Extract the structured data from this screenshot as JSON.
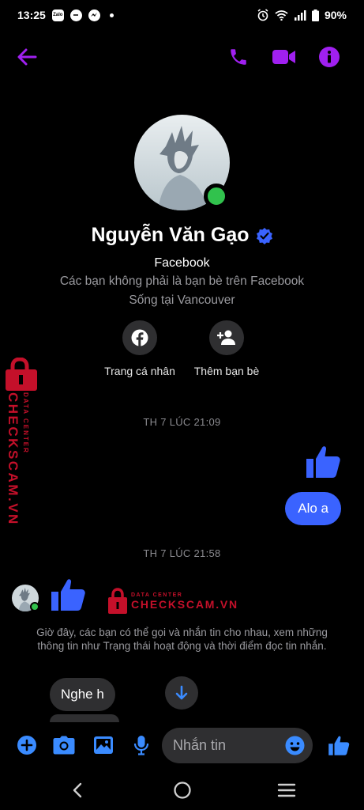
{
  "status_bar": {
    "time": "13:25",
    "notifications": [
      {
        "icon": "zalo-icon",
        "text": "Zalo"
      },
      {
        "icon": "chat-bubble-icon",
        "text": ""
      },
      {
        "icon": "messenger-icon",
        "text": ""
      }
    ],
    "battery": "90%"
  },
  "header": {
    "back": "back-arrow-icon",
    "call": "phone-icon",
    "video": "video-camera-icon",
    "info": "info-icon"
  },
  "profile": {
    "name": "Nguyễn Văn Gạo",
    "verified": true,
    "platform": "Facebook",
    "friend_status": "Các bạn không phải là bạn bè trên Facebook",
    "lives_in": "Sống tại Vancouver",
    "actions": [
      {
        "icon": "facebook-icon",
        "label": "Trang cá nhân"
      },
      {
        "icon": "add-friend-icon",
        "label": "Thêm bạn bè"
      }
    ]
  },
  "watermark": {
    "small": "DATA CENTER",
    "big": "CHECKSCAM.VN"
  },
  "messages": {
    "timestamp_1": "TH 7 LÚC 21:09",
    "outgoing_text": "Alo a",
    "timestamp_2": "TH 7 LÚC 21:58",
    "system_notice": "Giờ đây, các bạn có thể gọi và nhắn tin cho nhau, xem những thông tin như Trạng thái hoạt động và thời điểm đọc tin nhắn.",
    "incoming_text": "Nghe h"
  },
  "composer": {
    "placeholder": "Nhắn tin",
    "buttons": [
      "plus-icon",
      "camera-icon",
      "image-icon",
      "microphone-icon",
      "emoji-icon",
      "like-icon"
    ]
  },
  "colors": {
    "accent": "#3a63ff",
    "header_icons": "#a020f0",
    "online": "#31c24d",
    "watermark": "#c4102a"
  }
}
